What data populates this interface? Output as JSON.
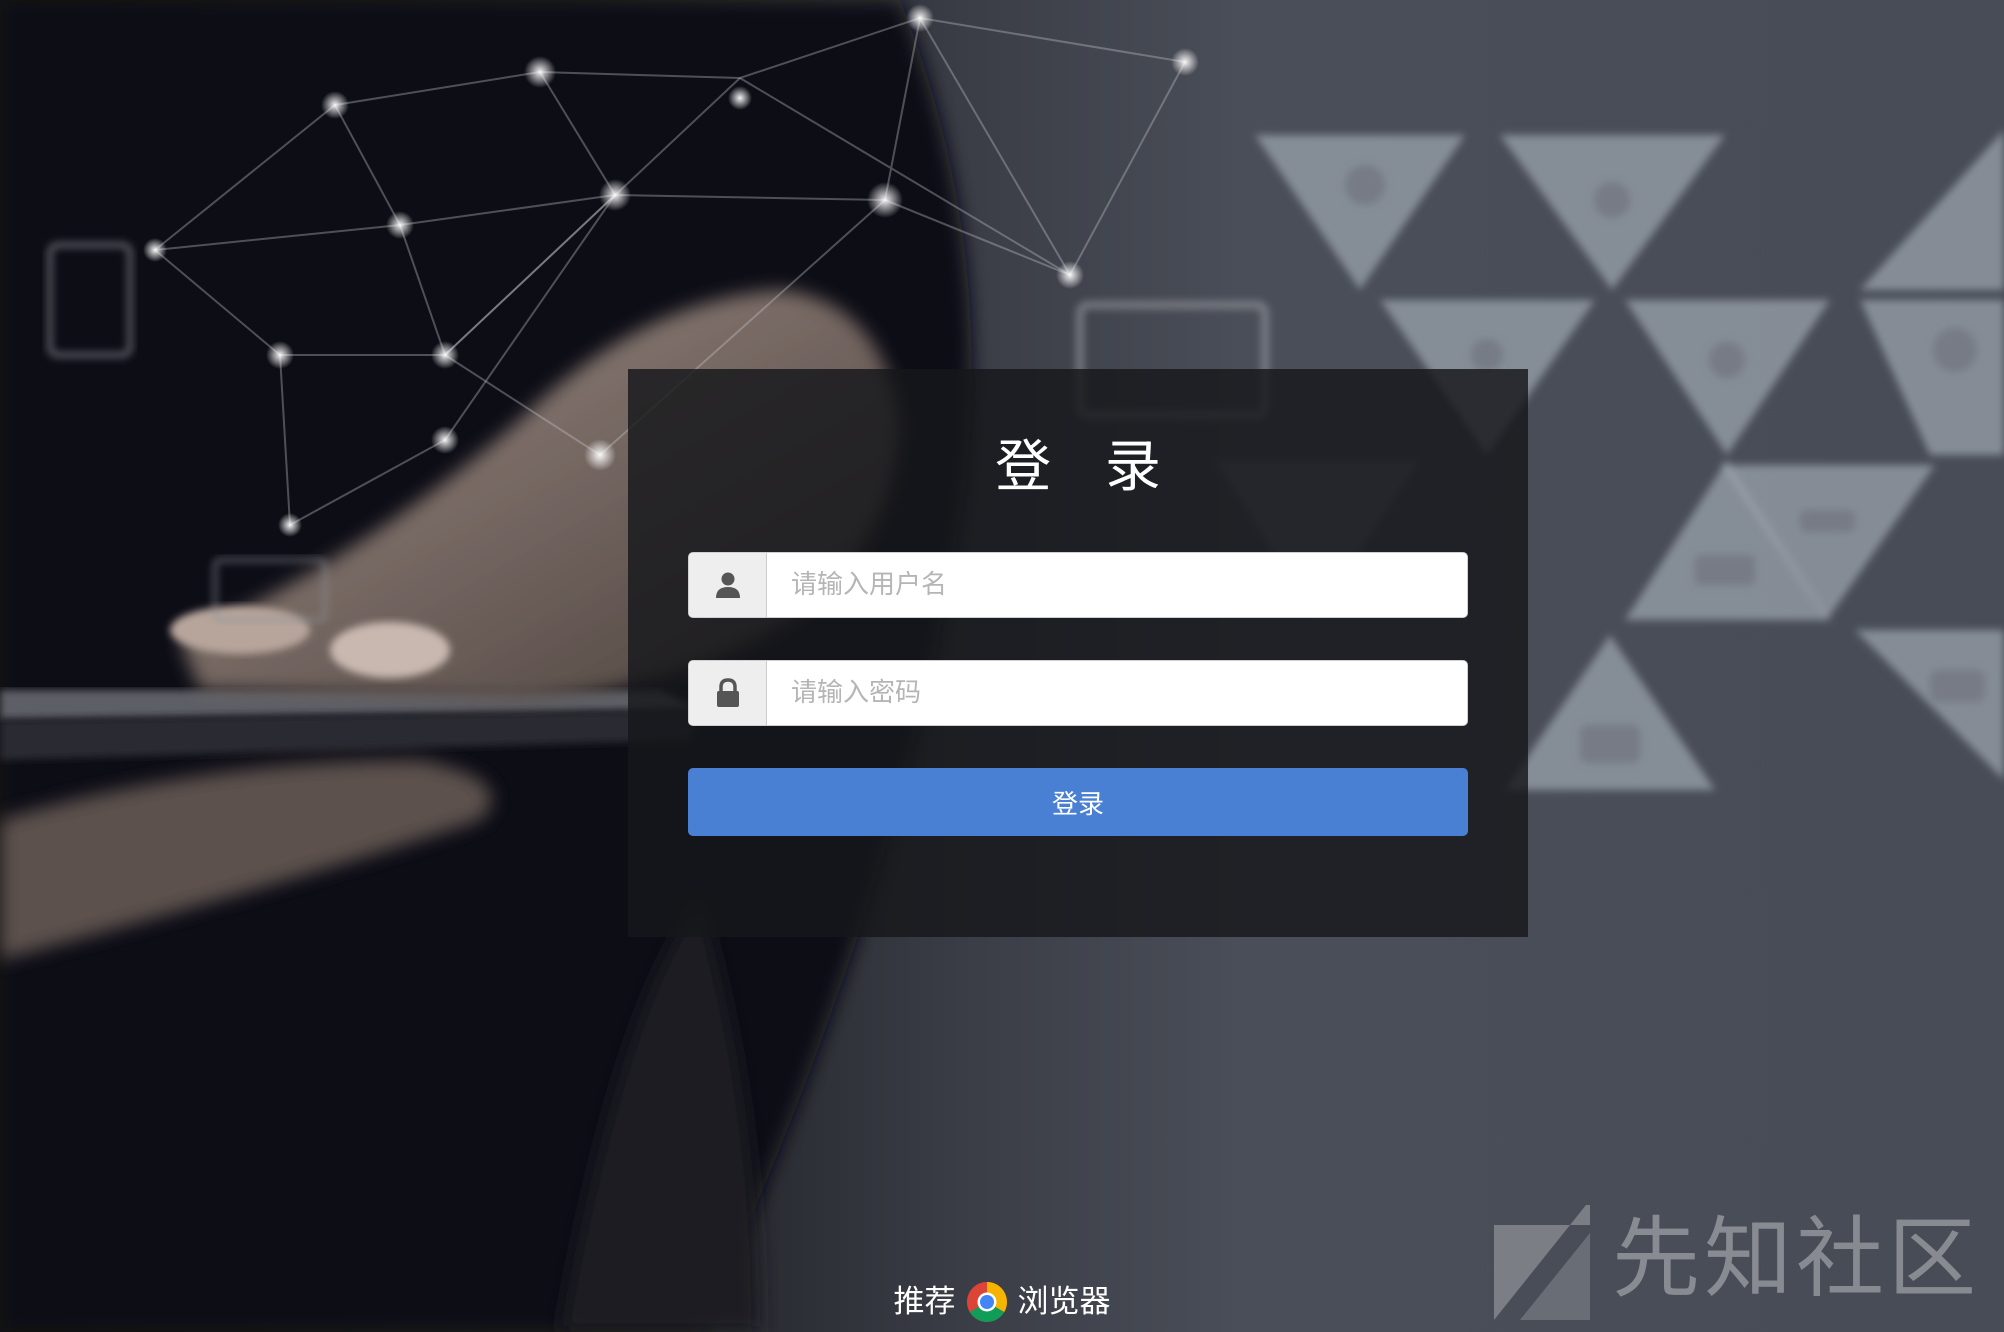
{
  "login": {
    "title": "登 录",
    "username_placeholder": "请输入用户名",
    "password_placeholder": "请输入密码",
    "submit_label": "登录"
  },
  "footer": {
    "prefix": "推荐",
    "browser_icon": "chrome-icon",
    "suffix": "浏览器"
  },
  "watermark": {
    "text": "先知社区"
  },
  "colors": {
    "button": "#4a80d3",
    "panel": "#16171b",
    "background": "#484c56"
  }
}
